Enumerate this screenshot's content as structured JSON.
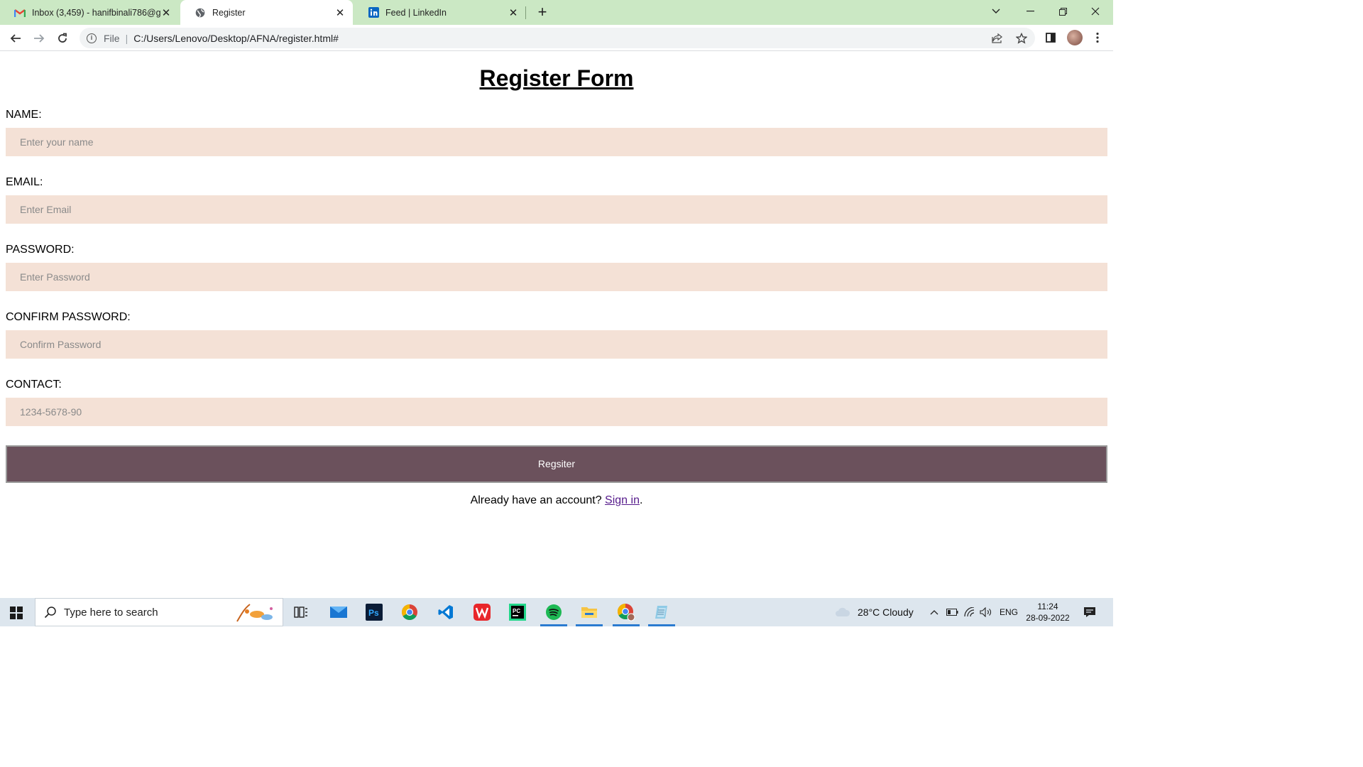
{
  "browser": {
    "tabs": [
      {
        "title": "Inbox (3,459) - hanifbinali786@g",
        "icon": "gmail-icon",
        "active": false
      },
      {
        "title": "Register",
        "icon": "globe-icon",
        "active": true
      },
      {
        "title": "Feed | LinkedIn",
        "icon": "linkedin-icon",
        "active": false
      }
    ],
    "omnibox": {
      "scheme_label": "File",
      "url": "C:/Users/Lenovo/Desktop/AFNA/register.html#"
    }
  },
  "page": {
    "title": "Register Form",
    "fields": [
      {
        "label": "NAME:",
        "placeholder": "Enter your name",
        "value": ""
      },
      {
        "label": "EMAIL:",
        "placeholder": "Enter Email",
        "value": ""
      },
      {
        "label": "PASSWORD:",
        "placeholder": "Enter Password",
        "value": ""
      },
      {
        "label": "CONFIRM PASSWORD:",
        "placeholder": "Confirm Password",
        "value": ""
      },
      {
        "label": "CONTACT:",
        "placeholder": "1234-5678-90",
        "value": ""
      }
    ],
    "submit_label": "Regsiter",
    "signin_prefix": "Already have an account? ",
    "signin_link": "Sign in",
    "signin_suffix": "."
  },
  "taskbar": {
    "search_placeholder": "Type here to search",
    "weather": "28°C  Cloudy",
    "language": "ENG",
    "time": "11:24",
    "date": "28-09-2022"
  },
  "colors": {
    "tab_strip": "#cbe8c4",
    "input_bg": "#f4e1d6",
    "button_bg": "#6b515c",
    "link": "#551a8b"
  }
}
